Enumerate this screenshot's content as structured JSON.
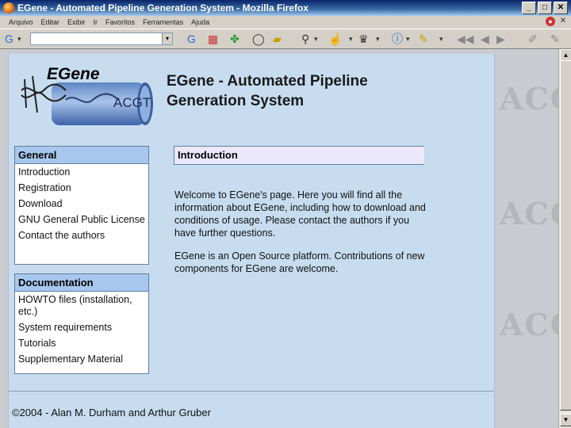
{
  "window": {
    "title": "EGene - Automated Pipeline Generation System - Mozilla Firefox"
  },
  "menu": [
    "Arquivo",
    "Editar",
    "Exibir",
    "Ir",
    "Favoritos",
    "Ferramentas",
    "Ajuda"
  ],
  "toolbar": {
    "url_value": ""
  },
  "logo": {
    "text": "EGene",
    "tube_text": "ACGT"
  },
  "header": {
    "title": "EGene - Automated Pipeline Generation System"
  },
  "nav": {
    "general": {
      "heading": "General",
      "items": [
        "Introduction",
        "Registration",
        "Download",
        "GNU General Public License",
        "Contact the authors"
      ]
    },
    "documentation": {
      "heading": "Documentation",
      "items": [
        "HOWTO files (installation, etc.)",
        "System requirements",
        "Tutorials",
        "Supplementary Material"
      ]
    }
  },
  "main": {
    "heading": "Introduction",
    "paragraphs": [
      "Welcome to EGene's page. Here you will find all the information about EGene, including how to download and conditions of usage. Please contact the authors if you have further questions.",
      "EGene is an Open Source platform. Contributions of new components for EGene are welcome."
    ]
  },
  "footer": {
    "text": "©2004 - Alan M. Durham and Arthur Gruber"
  },
  "watermark": "ACGT"
}
